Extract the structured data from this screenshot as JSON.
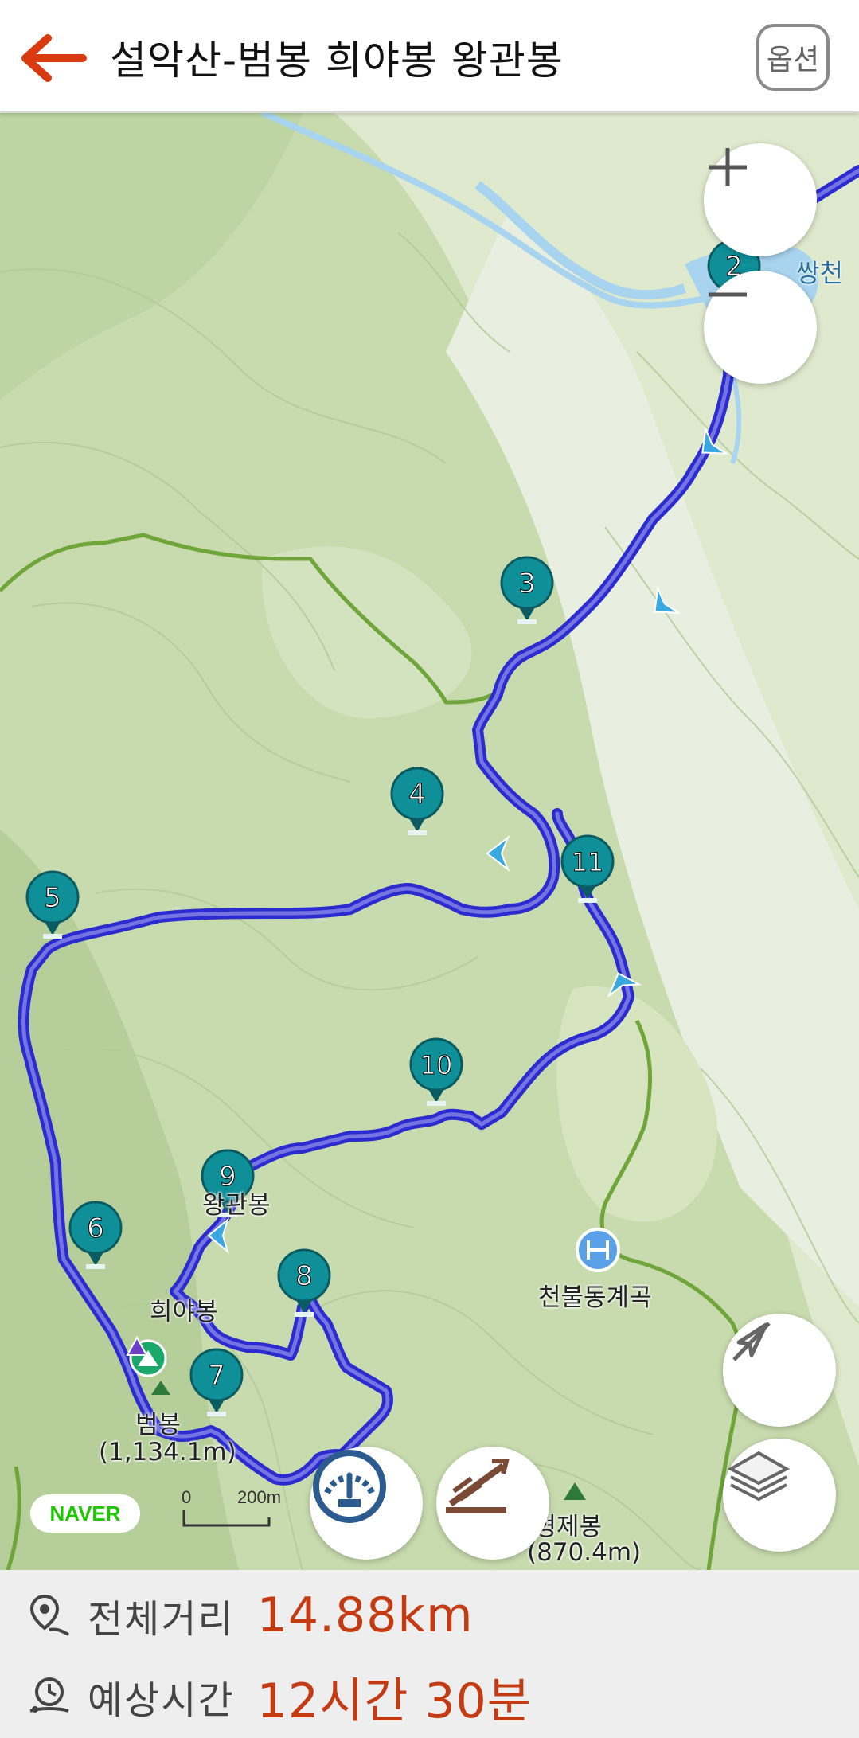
{
  "header": {
    "title": "설악산-범봉 희야봉 왕관봉",
    "option_label": "옵션"
  },
  "map": {
    "place_labels": {
      "ssangcheon": "쌍천",
      "cheonbuldong": "천불동계곡",
      "hiyabong": "희야봉",
      "beombong_name": "범봉",
      "beombong_elev": "(1,134.1m)",
      "wanggwanbong": "왕관봉",
      "chilhyeongjebong_name": "칠형제봉",
      "chilhyeongjebong_elev": "(870.4m)"
    },
    "waypoints": [
      "2",
      "3",
      "4",
      "5",
      "6",
      "7",
      "8",
      "9",
      "10",
      "11"
    ],
    "naver_logo": "NAVER",
    "scale": {
      "zero": "0",
      "distance": "200m"
    },
    "zoom_in_icon": "plus-icon",
    "zoom_out_icon": "minus-icon",
    "colors": {
      "route": "#2b2bd0",
      "marker": "#0f8f98",
      "trail": "#6fa53a",
      "water": "#a9d4ef",
      "accent": "#c43a12"
    }
  },
  "summary": {
    "distance_label": "전체거리",
    "distance_value": "14.88km",
    "time_label": "예상시간",
    "time_value": "12시간 30분"
  }
}
